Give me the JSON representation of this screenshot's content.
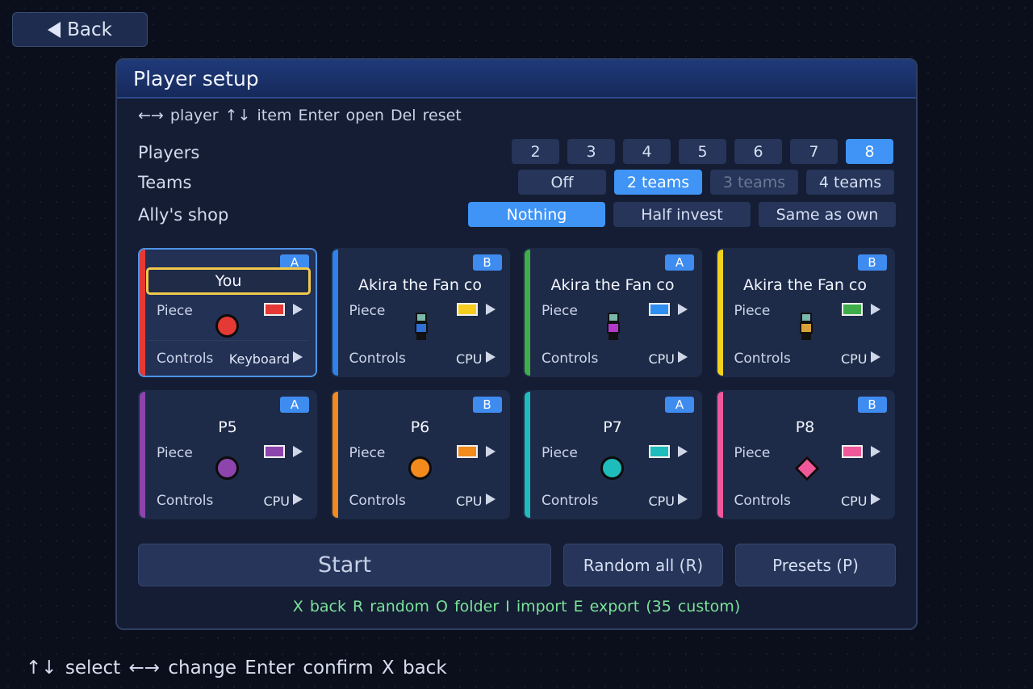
{
  "back": {
    "label": "Back"
  },
  "panel": {
    "title": "Player setup",
    "hint": "←→ player  ↑↓ item  Enter open  Del reset"
  },
  "players": {
    "label": "Players",
    "options": [
      "2",
      "3",
      "4",
      "5",
      "6",
      "7",
      "8"
    ],
    "selected": "8"
  },
  "teams": {
    "label": "Teams",
    "options": [
      "Off",
      "2 teams",
      "3 teams",
      "4 teams"
    ],
    "selected": "2 teams",
    "disabled": [
      "3 teams"
    ]
  },
  "shop": {
    "label": "Ally's shop",
    "options": [
      "Nothing",
      "Half invest",
      "Same as own"
    ],
    "selected": "Nothing"
  },
  "card_labels": {
    "piece": "Piece",
    "controls": "Controls"
  },
  "cards": [
    {
      "name": "You",
      "team": "A",
      "color": "#e53935",
      "piece": "circle",
      "controls": "Keyboard",
      "stripe": "#e53935"
    },
    {
      "name": "Akira the Fan co",
      "team": "B",
      "color": "#f6cd1e",
      "piece": "sprite",
      "sprite_color": "#2f6fd6",
      "controls": "CPU",
      "stripe": "#2f83e8"
    },
    {
      "name": "Akira the Fan co",
      "team": "A",
      "color": "#2e8ff0",
      "piece": "sprite",
      "sprite_color": "#b23ac8",
      "controls": "CPU",
      "stripe": "#3fae4a"
    },
    {
      "name": "Akira the Fan co",
      "team": "B",
      "color": "#3fae4a",
      "piece": "sprite",
      "sprite_color": "#d8a23a",
      "controls": "CPU",
      "stripe": "#f2d21e"
    },
    {
      "name": "P5",
      "team": "A",
      "color": "#8e44ad",
      "piece": "circle",
      "controls": "CPU",
      "stripe": "#8e44ad"
    },
    {
      "name": "P6",
      "team": "B",
      "color": "#f28a1e",
      "piece": "circle",
      "controls": "CPU",
      "stripe": "#f28a1e"
    },
    {
      "name": "P7",
      "team": "A",
      "color": "#1fbcbc",
      "piece": "circle",
      "controls": "CPU",
      "stripe": "#1fbcbc"
    },
    {
      "name": "P8",
      "team": "B",
      "color": "#f0589a",
      "piece": "diamond",
      "controls": "CPU",
      "stripe": "#f0589a"
    }
  ],
  "actions": {
    "start": "Start",
    "random_all": "Random all (R)",
    "presets": "Presets (P)"
  },
  "hint_green": "X back  R random  O folder  I import  E export  (35 custom)",
  "footer_hint": "↑↓ select  ←→ change  Enter confirm  X back"
}
